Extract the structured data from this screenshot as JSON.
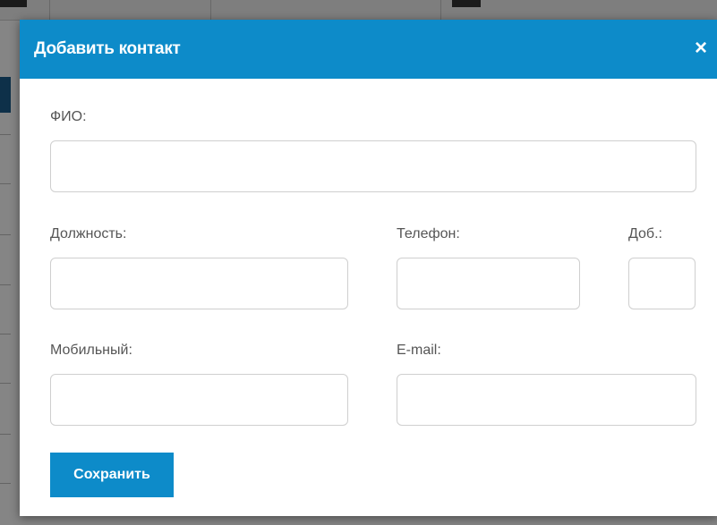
{
  "dialog": {
    "title": "Добавить контакт",
    "close_glyph": "×"
  },
  "form": {
    "fio_label": "ФИО:",
    "fio_value": "",
    "position_label": "Должность:",
    "position_value": "",
    "phone_label": "Телефон:",
    "phone_value": "",
    "ext_label": "Доб.:",
    "ext_value": "",
    "mobile_label": "Мобильный:",
    "mobile_value": "",
    "email_label": "E-mail:",
    "email_value": ""
  },
  "actions": {
    "save_label": "Сохранить"
  },
  "colors": {
    "header": "#0d8bc9",
    "button": "#0d8bc9",
    "overlay": "rgba(0,0,0,0.48)"
  },
  "icons": {
    "close": "close-icon"
  }
}
